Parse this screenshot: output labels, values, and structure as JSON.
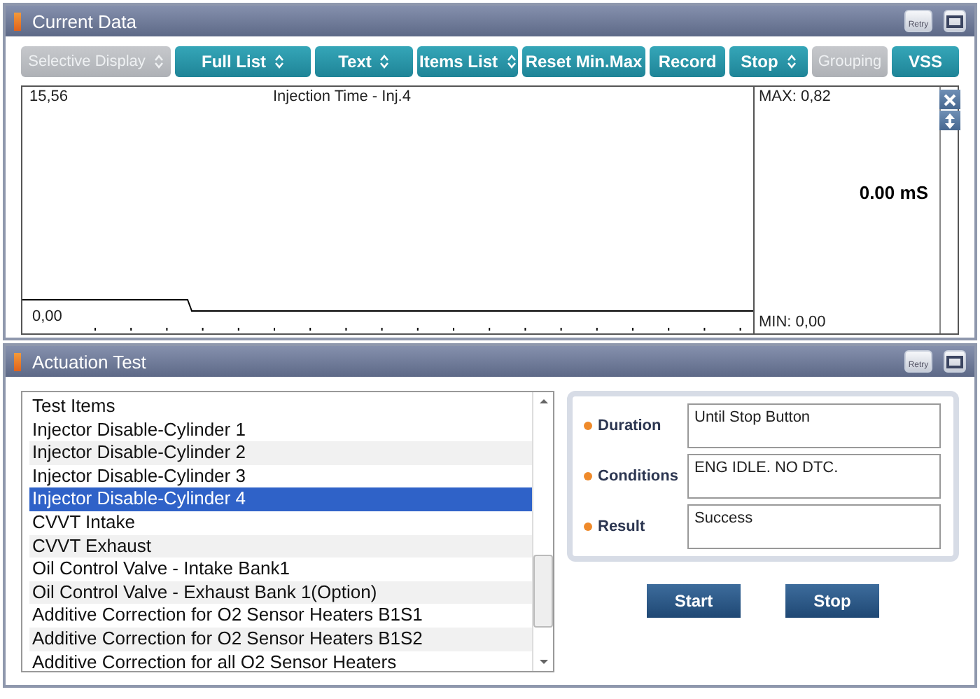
{
  "current_data": {
    "title": "Current Data",
    "retry_label": "Retry",
    "toolbar": [
      {
        "label": "Selective Display",
        "kind": "dropdown",
        "disabled": true
      },
      {
        "label": "Full List",
        "kind": "dropdown",
        "disabled": false
      },
      {
        "label": "Text",
        "kind": "dropdown",
        "disabled": false
      },
      {
        "label": "Items List",
        "kind": "dropdown",
        "disabled": false
      },
      {
        "label": "Reset Min.Max",
        "kind": "button",
        "disabled": false
      },
      {
        "label": "Record",
        "kind": "button",
        "disabled": false
      },
      {
        "label": "Stop",
        "kind": "dropdown",
        "disabled": false
      },
      {
        "label": "Grouping",
        "kind": "button",
        "disabled": true
      },
      {
        "label": "VSS",
        "kind": "button",
        "disabled": false
      }
    ],
    "graph": {
      "top_value": "15,56",
      "bottom_value": "0,00",
      "title": "Injection Time - Inj.4",
      "max": "MAX: 0,82",
      "min": "MIN: 0,00",
      "reading": "0.00 mS"
    }
  },
  "actuation_test": {
    "title": "Actuation Test",
    "retry_label": "Retry",
    "list": {
      "header": "Test Items",
      "items": [
        {
          "label": "Injector Disable-Cylinder 1",
          "selected": false
        },
        {
          "label": "Injector Disable-Cylinder 2",
          "selected": false
        },
        {
          "label": "Injector Disable-Cylinder 3",
          "selected": false
        },
        {
          "label": "Injector Disable-Cylinder 4",
          "selected": true
        },
        {
          "label": "CVVT Intake",
          "selected": false
        },
        {
          "label": "CVVT Exhaust",
          "selected": false
        },
        {
          "label": "Oil Control Valve - Intake Bank1",
          "selected": false
        },
        {
          "label": "Oil Control Valve - Exhaust Bank 1(Option)",
          "selected": false
        },
        {
          "label": "Additive Correction for O2 Sensor Heaters B1S1",
          "selected": false
        },
        {
          "label": "Additive Correction for O2 Sensor Heaters B1S2",
          "selected": false
        },
        {
          "label": "Additive Correction for all O2 Sensor Heaters",
          "selected": false
        }
      ]
    },
    "fields": [
      {
        "label": "Duration",
        "value": "Until Stop Button"
      },
      {
        "label": "Conditions",
        "value": "ENG IDLE. NO DTC."
      },
      {
        "label": "Result",
        "value": "Success"
      }
    ],
    "buttons": [
      "Start",
      "Stop"
    ]
  }
}
